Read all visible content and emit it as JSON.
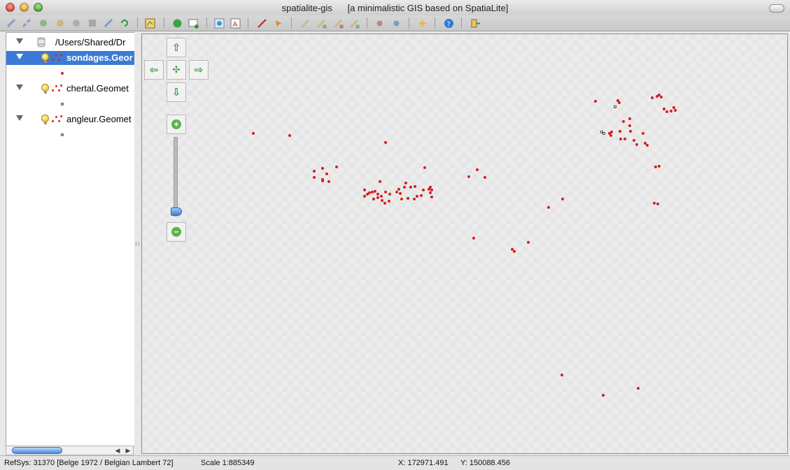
{
  "window": {
    "title": "spatialite-gis      [a minimalistic GIS based on SpatiaLite]"
  },
  "toolbar": {
    "icons": [
      "connect-icon",
      "disconnect-icon",
      "layer-add-icon",
      "layer-remove-icon",
      "vector-icon",
      "raster-icon",
      "srid-icon",
      "refresh-icon",
      "map-config-icon",
      "identify-icon",
      "table-icon",
      "zoom-extent-icon",
      "label-icon",
      "measure-icon",
      "select-icon",
      "edit-icon",
      "edit-add-icon",
      "edit-delete-icon",
      "edit-move-icon",
      "undo-icon",
      "redo-icon",
      "highlight-icon",
      "help-icon",
      "exit-icon"
    ]
  },
  "tree": {
    "root_label": "/Users/Shared/Dr",
    "layers": [
      {
        "label": "sondages.Geor",
        "selected": true,
        "symbol_color": "#d42020"
      },
      {
        "label": "chertal.Geomet",
        "selected": false,
        "symbol_color": "#ffffff"
      },
      {
        "label": "angleur.Geomet",
        "selected": false,
        "symbol_color": "#ffffff"
      }
    ]
  },
  "map_controls": {
    "pan_up": "⇧",
    "pan_left": "⇦",
    "pan_right": "⇨",
    "pan_down": "⇩",
    "zoom_full": "✣",
    "zoom_in": "+",
    "zoom_out": "−",
    "zoom_level_fraction": 0.9
  },
  "status": {
    "refsys": "RefSys: 31370 [Belge 1972 / Belgian Lambert 72]",
    "scale": "Scale 1:885349",
    "x": "X: 172971.491",
    "y": "Y: 150088.456"
  },
  "colors": {
    "point_red": "#d42020",
    "selection_blue": "#3b7bd6"
  }
}
